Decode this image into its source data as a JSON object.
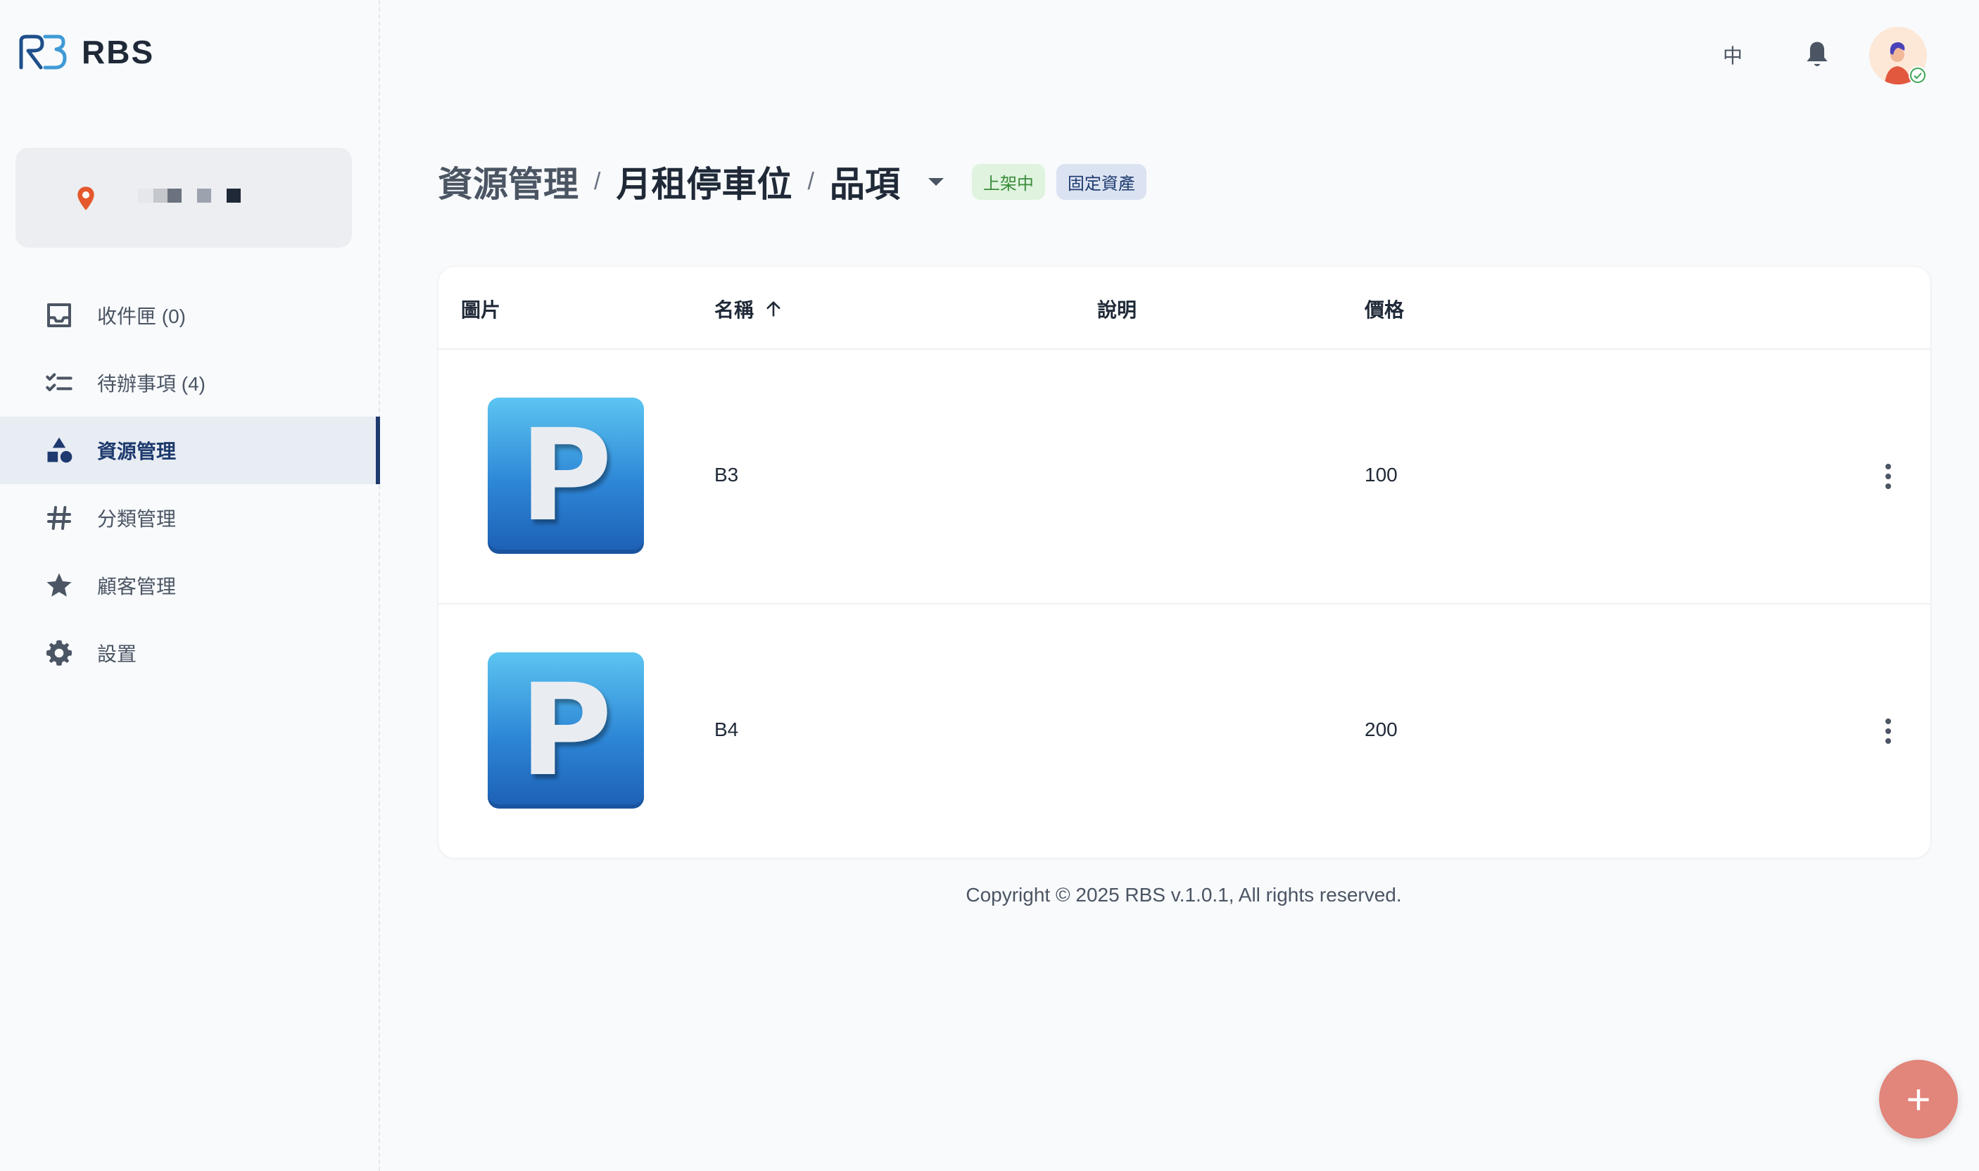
{
  "app": {
    "name": "RBS"
  },
  "sidebar": {
    "items": [
      {
        "label": "收件匣 (0)",
        "icon": "inbox-icon"
      },
      {
        "label": "待辦事項 (4)",
        "icon": "checklist-icon"
      },
      {
        "label": "資源管理",
        "icon": "shapes-icon",
        "active": true
      },
      {
        "label": "分類管理",
        "icon": "hashtag-icon"
      },
      {
        "label": "顧客管理",
        "icon": "star-icon"
      },
      {
        "label": "設置",
        "icon": "gear-icon"
      }
    ]
  },
  "topbar": {
    "language": "中"
  },
  "breadcrumb": {
    "level1": "資源管理",
    "level2": "月租停車位",
    "level3": "品項",
    "separator": "/"
  },
  "badges": {
    "status": "上架中",
    "type": "固定資產"
  },
  "table": {
    "headers": {
      "image": "圖片",
      "name": "名稱",
      "description": "說明",
      "price": "價格"
    },
    "rows": [
      {
        "image_letter": "P",
        "name": "B3",
        "description": "",
        "price": "100"
      },
      {
        "image_letter": "P",
        "name": "B4",
        "description": "",
        "price": "200"
      }
    ]
  },
  "footer": {
    "copyright": "Copyright © 2025 RBS v.1.0.1, All rights reserved."
  },
  "fab": {
    "label": "+"
  },
  "colors": {
    "accent": "#1e3a6e",
    "fab": "#e2857a",
    "badge_green": "#3a8d3b"
  }
}
